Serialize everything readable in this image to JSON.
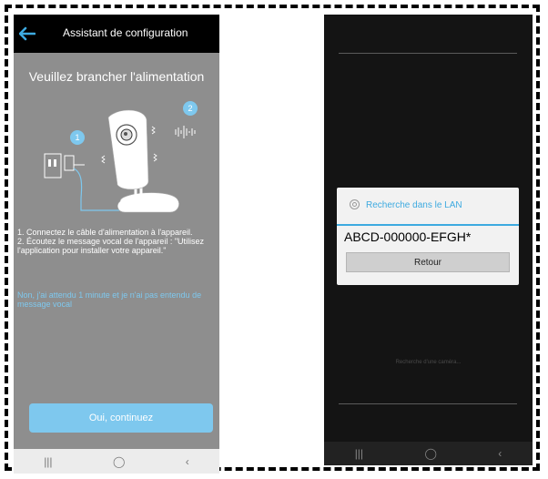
{
  "screen1": {
    "header_title": "Assistant de configuration",
    "heading": "Veuillez brancher l'alimentation",
    "step1_badge": "1",
    "step2_badge": "2",
    "instructions": "1. Connectez le câble d'alimentation à l'appareil.\n2. Écoutez le message vocal de l'appareil : \"Utilisez l'application pour installer votre appareil.\"",
    "no_voice_link": "Non, j'ai attendu 1 minute et je n'ai pas entendu de message vocal",
    "continue_button": "Oui, continuez",
    "nav": {
      "recent": "|||",
      "home": "◯",
      "back": "‹"
    },
    "colors": {
      "background": "#8e8e8e",
      "accent": "#7ec8ee",
      "header": "#000000"
    }
  },
  "screen2": {
    "dialog_title": "Recherche dans le LAN",
    "device_id": "ABCD-000000-EFGH*",
    "back_button": "Retour",
    "status_text": "Recherche d'une caméra...",
    "nav": {
      "recent": "|||",
      "home": "◯",
      "back": "‹"
    },
    "colors": {
      "background": "#141414",
      "accent": "#3daae0"
    }
  }
}
